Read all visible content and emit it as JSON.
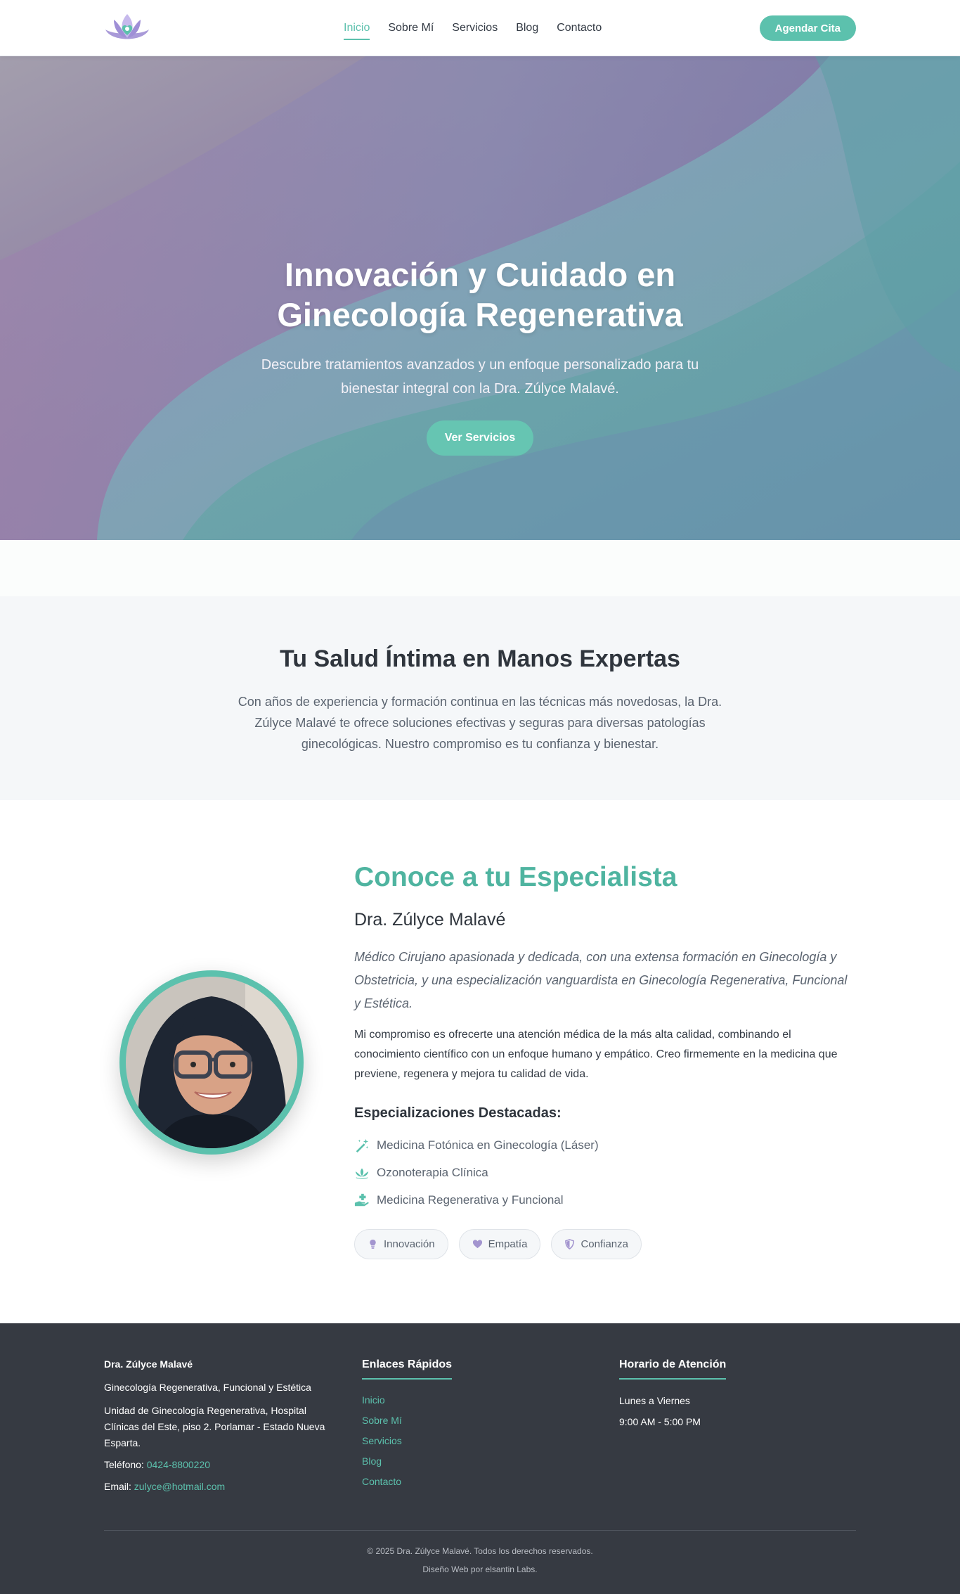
{
  "colors": {
    "accent": "#5cc1ad",
    "dark_footer": "#363a42",
    "hero_purple": "#8f7ea2",
    "hero_teal": "#6aa9a3"
  },
  "header": {
    "logo_icon": "lotus-heart-logo",
    "nav": [
      {
        "label": "Inicio",
        "active": true
      },
      {
        "label": "Sobre Mí",
        "active": false
      },
      {
        "label": "Servicios",
        "active": false
      },
      {
        "label": "Blog",
        "active": false
      },
      {
        "label": "Contacto",
        "active": false
      }
    ],
    "cta_label": "Agendar Cita"
  },
  "hero": {
    "title": "Innovación y Cuidado en Ginecología Regenerativa",
    "subtitle": "Descubre tratamientos avanzados y un enfoque personalizado para tu bienestar integral con la Dra. Zúlyce Malavé.",
    "button_label": "Ver Servicios"
  },
  "intro": {
    "title": "Tu Salud Íntima en Manos Expertas",
    "text": "Con años de experiencia y formación continua en las técnicas más novedosas, la Dra. Zúlyce Malavé te ofrece soluciones efectivas y seguras para diversas patologías ginecológicas. Nuestro compromiso es tu confianza y bienestar."
  },
  "specialist": {
    "title": "Conoce a tu Especialista",
    "name": "Dra. Zúlyce Malavé",
    "quote": "Médico Cirujano apasionada y dedicada, con una extensa formación en Ginecología y Obstetricia, y una especialización vanguardista en Ginecología Regenerativa, Funcional y Estética.",
    "body": "Mi compromiso es ofrecerte una atención médica de la más alta calidad, combinando el conocimiento científico con un enfoque humano y empático. Creo firmemente en la medicina que previene, regenera y mejora tu calidad de vida.",
    "subhead": "Especializaciones Destacadas:",
    "specializations": [
      {
        "label": "Medicina Fotónica en Ginecología (Láser)",
        "icon": "magic-wand-icon"
      },
      {
        "label": "Ozonoterapia Clínica",
        "icon": "lotus-icon"
      },
      {
        "label": "Medicina Regenerativa y Funcional",
        "icon": "hand-medical-icon"
      }
    ],
    "values": [
      {
        "label": "Innovación",
        "icon": "lightbulb-icon"
      },
      {
        "label": "Empatía",
        "icon": "heart-icon"
      },
      {
        "label": "Confianza",
        "icon": "shield-icon"
      }
    ]
  },
  "footer": {
    "name": "Dra. Zúlyce Malavé",
    "tagline": "Ginecología Regenerativa, Funcional y Estética",
    "address": "Unidad de Ginecología Regenerativa, Hospital Clínicas del Este, piso 2. Porlamar - Estado Nueva Esparta.",
    "phone_label": "Teléfono:",
    "phone": "0424-8800220",
    "email_label": "Email:",
    "email": "zulyce@hotmail.com",
    "links_title": "Enlaces Rápidos",
    "links": [
      "Inicio",
      "Sobre Mí",
      "Servicios",
      "Blog",
      "Contacto"
    ],
    "hours_title": "Horario de Atención",
    "hours_days": "Lunes a Viernes",
    "hours_time": "9:00 AM - 5:00 PM",
    "copyright": "© 2025 Dra. Zúlyce Malavé. Todos los derechos reservados.",
    "credit": "Diseño Web por elsantin Labs."
  }
}
